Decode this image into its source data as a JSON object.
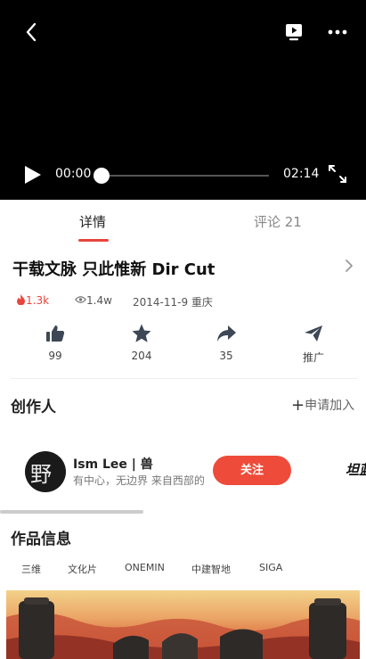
{
  "player": {
    "icons": {
      "back": "back-arrow-icon",
      "tv": "tv-play-icon",
      "more": "more-dots-icon",
      "play": "play-icon",
      "fullscreen": "fullscreen-icon"
    },
    "current_time": "00:00",
    "duration": "02:14",
    "progress": 0
  },
  "tabs": [
    {
      "label": "详情",
      "active": true
    },
    {
      "label": "评论 21",
      "active": false
    }
  ],
  "video": {
    "title": "干载文脉 只此惟新 Dir Cut",
    "heat": "1.3k",
    "views": "1.4w",
    "date_location": "2014-11-9 重庆"
  },
  "actions": [
    {
      "icon": "thumbs-up-icon",
      "label": "99"
    },
    {
      "icon": "star-icon",
      "label": "204"
    },
    {
      "icon": "share-arrow-icon",
      "label": "35"
    },
    {
      "icon": "paper-plane-icon",
      "label": "推广"
    }
  ],
  "creators": {
    "title": "创作人",
    "apply_label": "申请加入",
    "items": [
      {
        "name": "Ism Lee | 兽",
        "desc": "有中心，无边界 来自西部的",
        "follow_label": "关注"
      }
    ],
    "next_logo_text": "坦蓝"
  },
  "work_info": {
    "title": "作品信息",
    "tags": [
      "三维",
      "文化片",
      "ONEMIN",
      "中建智地",
      "SIGA"
    ]
  },
  "colors": {
    "accent": "#e8453c",
    "player_bg": "#000000"
  }
}
